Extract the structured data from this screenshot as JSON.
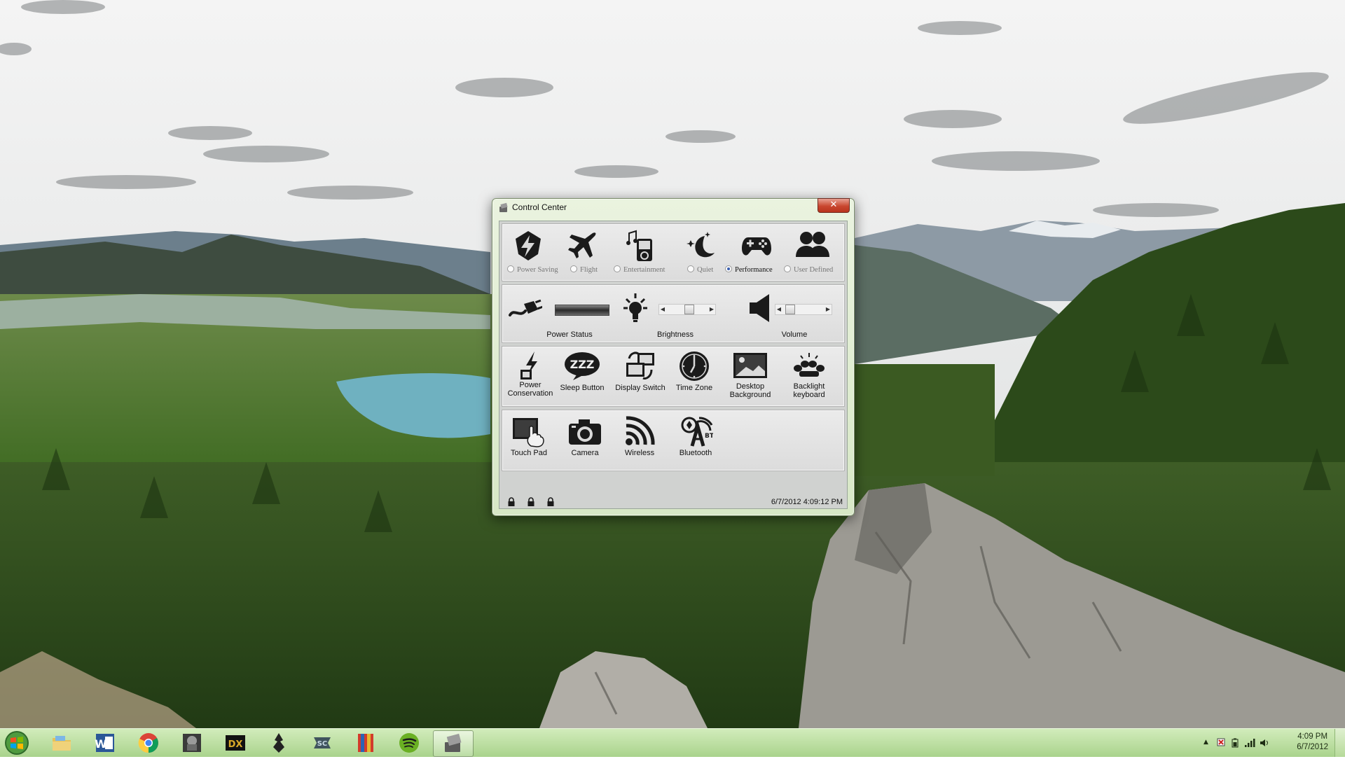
{
  "window": {
    "title": "Control Center",
    "close_label": "✕"
  },
  "modes": [
    {
      "label": "Power Saving",
      "icon": "power-saving-icon",
      "selected": false
    },
    {
      "label": "Flight",
      "icon": "airplane-icon",
      "selected": false
    },
    {
      "label": "Entertainment",
      "icon": "media-player-icon",
      "selected": false
    },
    {
      "label": "Quiet",
      "icon": "moon-icon",
      "selected": false
    },
    {
      "label": "Performance",
      "icon": "gamepad-icon",
      "selected": true
    },
    {
      "label": "User Defined",
      "icon": "users-icon",
      "selected": false
    }
  ],
  "status_row": {
    "power_status": "Power Status",
    "brightness": "Brightness",
    "brightness_level": 0.5,
    "volume": "Volume",
    "volume_level": 0.2
  },
  "tools_row": [
    {
      "label": "Power Conservation",
      "icon": "power-conservation-icon"
    },
    {
      "label": "Sleep Button",
      "icon": "sleep-icon"
    },
    {
      "label": "Display Switch",
      "icon": "display-switch-icon"
    },
    {
      "label": "Time Zone",
      "icon": "clock-icon"
    },
    {
      "label": "Desktop Background",
      "icon": "desktop-background-icon"
    },
    {
      "label": "Backlight keyboard",
      "icon": "backlight-keyboard-icon"
    }
  ],
  "device_row": [
    {
      "label": "Touch Pad",
      "icon": "touchpad-icon"
    },
    {
      "label": "Camera",
      "icon": "camera-icon"
    },
    {
      "label": "Wireless",
      "icon": "wireless-icon"
    },
    {
      "label": "Bluetooth",
      "icon": "bluetooth-icon"
    }
  ],
  "statusbar": {
    "timestamp": "6/7/2012 4:09:12 PM"
  },
  "taskbar": {
    "pinned": [
      "start-orb-icon",
      "file-explorer-icon",
      "word-icon",
      "chrome-icon",
      "game-icon",
      "deus-ex-icon",
      "skyrim-icon",
      "starcraft-icon",
      "game-book-icon",
      "spotify-icon",
      "control-center-icon"
    ],
    "clock_time": "4:09 PM",
    "clock_date": "6/7/2012"
  },
  "colors": {
    "taskbar": "#b7dc9c",
    "window_frame": "#dcebcc",
    "close_button": "#c9472f"
  }
}
